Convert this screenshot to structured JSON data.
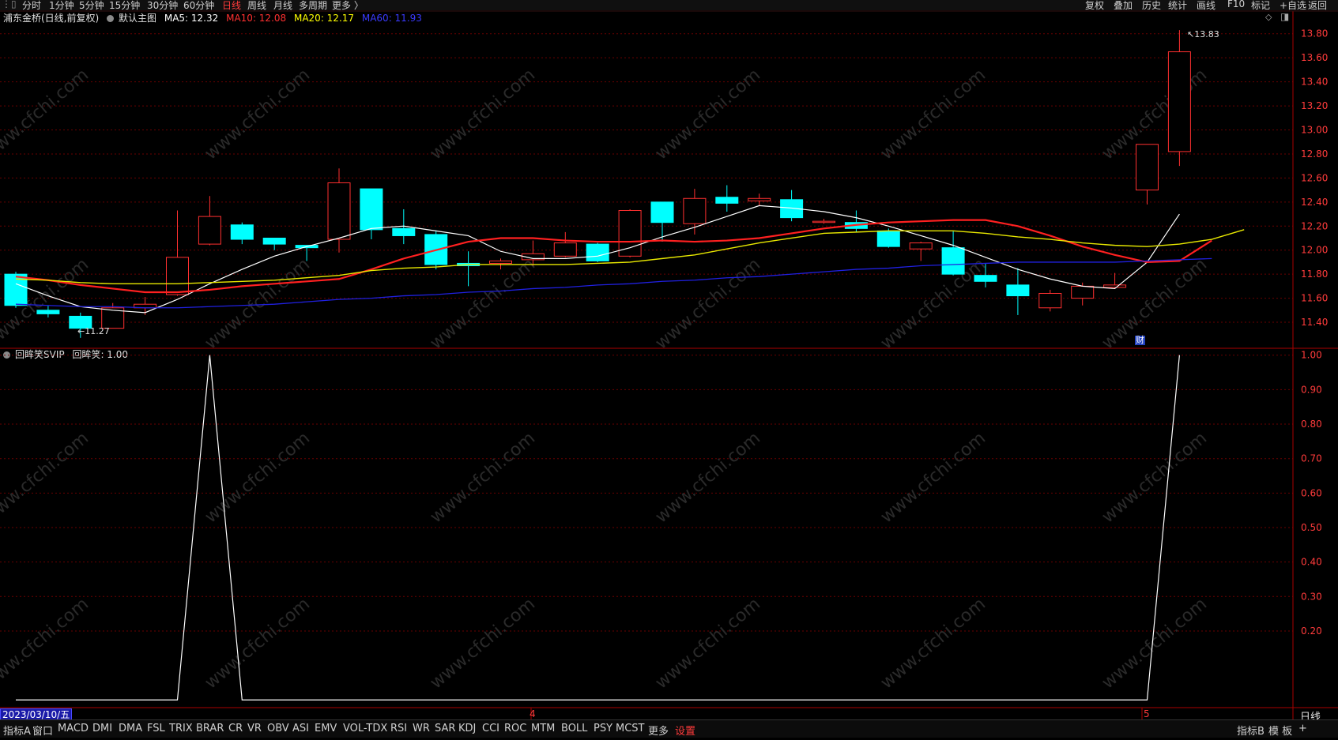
{
  "topbar": {
    "items": [
      {
        "label": "分时"
      },
      {
        "label": "1分钟"
      },
      {
        "label": "5分钟"
      },
      {
        "label": "15分钟"
      },
      {
        "label": "30分钟"
      },
      {
        "label": "60分钟"
      },
      {
        "label": "日线"
      },
      {
        "label": "周线"
      },
      {
        "label": "月线"
      },
      {
        "label": "多周期"
      },
      {
        "label": "更多 〉"
      }
    ],
    "active_index": 6,
    "right_items": [
      {
        "label": "复权"
      },
      {
        "label": "叠加"
      },
      {
        "label": "历史"
      },
      {
        "label": "统计"
      },
      {
        "label": "画线"
      },
      {
        "label": "F10"
      },
      {
        "label": "标记"
      },
      {
        "label": "+自选"
      },
      {
        "label": "返回"
      }
    ]
  },
  "main_panel": {
    "stock_title": "浦东金桥(日线,前复权)",
    "chart_name": "默认主图",
    "ma": [
      {
        "label": "MA5: 12.32",
        "color": "#ffffff"
      },
      {
        "label": "MA10: 12.08",
        "color": "#ff3030"
      },
      {
        "label": "MA20: 12.17",
        "color": "#ffff00"
      },
      {
        "label": "MA60: 11.93",
        "color": "#3030ff"
      }
    ],
    "high_label": "13.83",
    "low_label": "11.27",
    "cai_label": "财"
  },
  "sub_panel": {
    "indicator_title": "回眸笑SVIP",
    "indicator_value": "回眸笑: 1.00"
  },
  "x_axis": {
    "date_label": "2023/03/10/五",
    "month_markers": [
      "4",
      "5"
    ],
    "period_label": "日线"
  },
  "bottombar": {
    "items": [
      {
        "label": "指标A"
      },
      {
        "label": "窗口"
      },
      {
        "label": "MACD"
      },
      {
        "label": "DMI"
      },
      {
        "label": "DMA"
      },
      {
        "label": "FSL"
      },
      {
        "label": "TRIX"
      },
      {
        "label": "BRAR"
      },
      {
        "label": "CR"
      },
      {
        "label": "VR"
      },
      {
        "label": "OBV"
      },
      {
        "label": "ASI"
      },
      {
        "label": "EMV"
      },
      {
        "label": "VOL-TDX"
      },
      {
        "label": "RSI"
      },
      {
        "label": "WR"
      },
      {
        "label": "SAR"
      },
      {
        "label": "KDJ"
      },
      {
        "label": "CCI"
      },
      {
        "label": "ROC"
      },
      {
        "label": "MTM"
      },
      {
        "label": "BOLL"
      },
      {
        "label": "PSY"
      },
      {
        "label": "MCST"
      },
      {
        "label": "更多"
      },
      {
        "label": "设置"
      }
    ],
    "right_items": [
      {
        "label": "指标B"
      },
      {
        "label": "模 板"
      },
      {
        "label": "+"
      }
    ]
  },
  "watermark": "www.cfchi.com",
  "colors": {
    "up": "#ff3030",
    "down": "#00ffff",
    "ma5": "#ffffff",
    "ma10": "#ff2020",
    "ma20": "#e8e800",
    "ma60": "#2020e0",
    "grid": "#6a0000",
    "indicator": "#ffffff"
  },
  "chart_data": [
    {
      "type": "candlestick",
      "title": "浦东金桥(日线,前复权)",
      "y_ticks": [
        11.4,
        11.6,
        11.8,
        12.0,
        12.2,
        12.4,
        12.6,
        12.8,
        13.0,
        13.2,
        13.4,
        13.6,
        13.8
      ],
      "ylim": [
        11.19,
        13.91
      ],
      "candles": [
        {
          "o": 11.8,
          "h": 11.82,
          "l": 11.52,
          "c": 11.54
        },
        {
          "o": 11.5,
          "h": 11.54,
          "l": 11.44,
          "c": 11.47
        },
        {
          "o": 11.45,
          "h": 11.48,
          "l": 11.27,
          "c": 11.35
        },
        {
          "o": 11.35,
          "h": 11.56,
          "l": 11.35,
          "c": 11.52
        },
        {
          "o": 11.52,
          "h": 11.61,
          "l": 11.46,
          "c": 11.55
        },
        {
          "o": 11.63,
          "h": 12.33,
          "l": 11.62,
          "c": 11.94
        },
        {
          "o": 12.05,
          "h": 12.45,
          "l": 12.04,
          "c": 12.28
        },
        {
          "o": 12.21,
          "h": 12.23,
          "l": 12.05,
          "c": 12.09
        },
        {
          "o": 12.1,
          "h": 12.1,
          "l": 12.0,
          "c": 12.05
        },
        {
          "o": 12.04,
          "h": 12.04,
          "l": 11.91,
          "c": 12.02
        },
        {
          "o": 12.09,
          "h": 12.68,
          "l": 11.98,
          "c": 12.56
        },
        {
          "o": 12.51,
          "h": 12.51,
          "l": 12.09,
          "c": 12.17
        },
        {
          "o": 12.18,
          "h": 12.34,
          "l": 12.05,
          "c": 12.12
        },
        {
          "o": 12.13,
          "h": 12.16,
          "l": 11.84,
          "c": 11.88
        },
        {
          "o": 11.89,
          "h": 11.99,
          "l": 11.7,
          "c": 11.87
        },
        {
          "o": 11.89,
          "h": 11.93,
          "l": 11.84,
          "c": 11.91
        },
        {
          "o": 11.92,
          "h": 12.08,
          "l": 11.87,
          "c": 11.97
        },
        {
          "o": 11.95,
          "h": 12.15,
          "l": 11.94,
          "c": 12.06
        },
        {
          "o": 12.05,
          "h": 12.06,
          "l": 11.9,
          "c": 11.91
        },
        {
          "o": 11.95,
          "h": 12.34,
          "l": 11.94,
          "c": 12.33
        },
        {
          "o": 12.4,
          "h": 12.4,
          "l": 12.07,
          "c": 12.23
        },
        {
          "o": 12.22,
          "h": 12.51,
          "l": 12.13,
          "c": 12.43
        },
        {
          "o": 12.44,
          "h": 12.54,
          "l": 12.32,
          "c": 12.39
        },
        {
          "o": 12.41,
          "h": 12.47,
          "l": 12.37,
          "c": 12.43
        },
        {
          "o": 12.42,
          "h": 12.5,
          "l": 12.24,
          "c": 12.27
        },
        {
          "o": 12.23,
          "h": 12.26,
          "l": 12.22,
          "c": 12.24
        },
        {
          "o": 12.23,
          "h": 12.33,
          "l": 12.15,
          "c": 12.18
        },
        {
          "o": 12.16,
          "h": 12.18,
          "l": 12.02,
          "c": 12.03
        },
        {
          "o": 12.01,
          "h": 12.07,
          "l": 11.91,
          "c": 12.06
        },
        {
          "o": 12.02,
          "h": 12.16,
          "l": 11.79,
          "c": 11.8
        },
        {
          "o": 11.79,
          "h": 11.89,
          "l": 11.69,
          "c": 11.74
        },
        {
          "o": 11.71,
          "h": 11.85,
          "l": 11.46,
          "c": 11.62
        },
        {
          "o": 11.52,
          "h": 11.67,
          "l": 11.49,
          "c": 11.64
        },
        {
          "o": 11.6,
          "h": 11.73,
          "l": 11.54,
          "c": 11.7
        },
        {
          "o": 11.69,
          "h": 11.81,
          "l": 11.68,
          "c": 11.71
        },
        {
          "o": 12.5,
          "h": 12.88,
          "l": 12.38,
          "c": 12.88
        },
        {
          "o": 12.82,
          "h": 13.83,
          "l": 12.7,
          "c": 13.65
        }
      ],
      "series": [
        {
          "name": "MA5",
          "values": [
            11.72,
            11.62,
            11.53,
            11.5,
            11.48,
            11.59,
            11.72,
            11.84,
            11.95,
            12.03,
            12.1,
            12.18,
            12.2,
            12.16,
            12.12,
            11.99,
            11.93,
            11.93,
            11.95,
            12.02,
            12.11,
            12.19,
            12.28,
            12.37,
            12.35,
            12.32,
            12.27,
            12.2,
            12.12,
            12.04,
            11.94,
            11.84,
            11.76,
            11.7,
            11.68,
            11.9,
            12.3
          ]
        },
        {
          "name": "MA10",
          "values": [
            11.78,
            11.75,
            11.71,
            11.68,
            11.65,
            11.65,
            11.67,
            11.7,
            11.72,
            11.74,
            11.76,
            11.84,
            11.93,
            12.0,
            12.07,
            12.1,
            12.1,
            12.08,
            12.07,
            12.07,
            12.08,
            12.07,
            12.08,
            12.1,
            12.14,
            12.18,
            12.21,
            12.23,
            12.24,
            12.25,
            12.25,
            12.2,
            12.12,
            12.03,
            11.96,
            11.9,
            11.91,
            12.08
          ]
        },
        {
          "name": "MA20",
          "values": [
            11.76,
            11.75,
            11.73,
            11.72,
            11.72,
            11.72,
            11.73,
            11.74,
            11.75,
            11.77,
            11.79,
            11.83,
            11.85,
            11.86,
            11.88,
            11.88,
            11.88,
            11.88,
            11.89,
            11.9,
            11.93,
            11.96,
            12.01,
            12.06,
            12.1,
            12.14,
            12.15,
            12.16,
            12.16,
            12.16,
            12.14,
            12.11,
            12.09,
            12.06,
            12.04,
            12.03,
            12.05,
            12.09,
            12.17
          ]
        },
        {
          "name": "MA60",
          "values": [
            11.55,
            11.54,
            11.53,
            11.53,
            11.52,
            11.52,
            11.53,
            11.54,
            11.55,
            11.57,
            11.59,
            11.6,
            11.62,
            11.63,
            11.65,
            11.66,
            11.68,
            11.69,
            11.71,
            11.72,
            11.74,
            11.75,
            11.77,
            11.78,
            11.8,
            11.82,
            11.84,
            11.85,
            11.87,
            11.88,
            11.89,
            11.9,
            11.9,
            11.9,
            11.9,
            11.91,
            11.92,
            11.93
          ]
        }
      ]
    },
    {
      "type": "line",
      "title": "回眸笑SVIP",
      "y_ticks": [
        0.2,
        0.3,
        0.4,
        0.5,
        0.6,
        0.7,
        0.8,
        0.9,
        1.0
      ],
      "ylim": [
        -0.02,
        1.02
      ],
      "series": [
        {
          "name": "回眸笑",
          "values": [
            0,
            0,
            0,
            0,
            0,
            0,
            1,
            0,
            0,
            0,
            0,
            0,
            0,
            0,
            0,
            0,
            0,
            0,
            0,
            0,
            0,
            0,
            0,
            0,
            0,
            0,
            0,
            0,
            0,
            0,
            0,
            0,
            0,
            0,
            0,
            0,
            1
          ]
        }
      ]
    }
  ]
}
